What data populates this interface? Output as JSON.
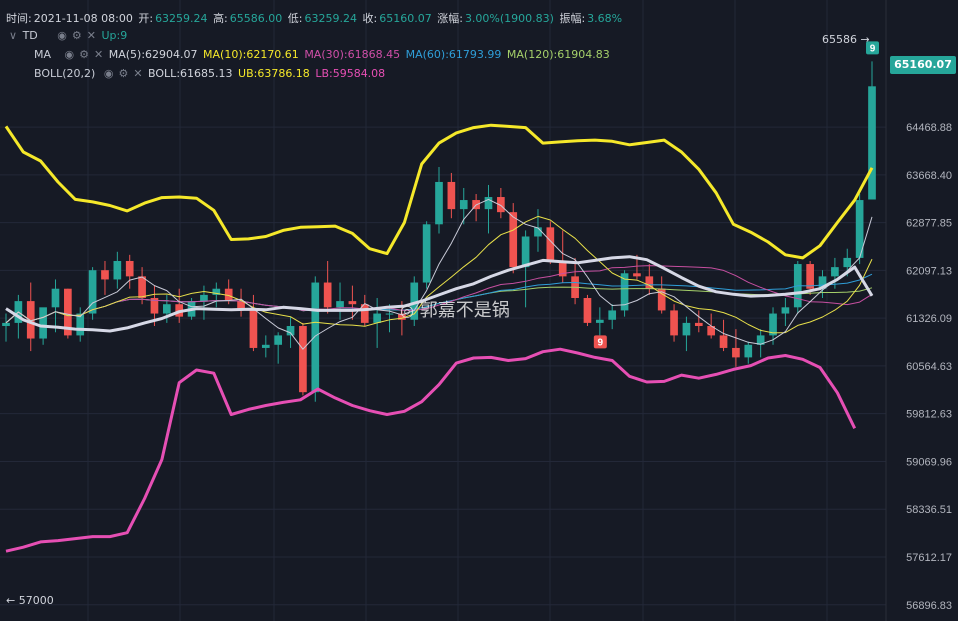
{
  "ohlc_line": {
    "time_label": "时间:",
    "time": "2021-11-08 08:00",
    "open_label": "开:",
    "open": "63259.24",
    "high_label": "高:",
    "high": "65586.00",
    "low_label": "低:",
    "low": "63259.24",
    "close_label": "收:",
    "close": "65160.07",
    "change_label": "涨幅:",
    "change": "3.00%(1900.83)",
    "amplitude_label": "振幅:",
    "amplitude": "3.68%"
  },
  "indicators": {
    "td": {
      "name": "TD",
      "value": "Up:9"
    },
    "ma": {
      "name": "MA",
      "ma5": "MA(5):62904.07",
      "ma10": "MA(10):62170.61",
      "ma30": "MA(30):61868.45",
      "ma60": "MA(60):61793.99",
      "ma120": "MA(120):61904.83"
    },
    "boll": {
      "name": "BOLL(20,2)",
      "mid": "BOLL:61685.13",
      "ub": "UB:63786.18",
      "lb": "LB:59584.08"
    }
  },
  "colors": {
    "bg": "#161a25",
    "up": "#26a69a",
    "down": "#ef5350",
    "grid": "#232838",
    "ma5": "#c9cbd8",
    "ma10": "#e8e04a",
    "ma30": "#c64fa0",
    "ma60": "#2f9ed8",
    "ma120": "#a5d06a",
    "boll": "#d6d8e6",
    "ub": "#f5e82a",
    "lb": "#e64fb4"
  },
  "price_axis": {
    "ticks": [
      "64468.88",
      "63668.40",
      "62877.85",
      "62097.13",
      "61326.09",
      "60564.63",
      "59812.63",
      "59069.96",
      "58336.51",
      "57612.17",
      "56896.83"
    ],
    "current_price": "65160.07",
    "high_marker": "65586 →",
    "low_marker": "← 57000"
  },
  "td_markers": [
    "9",
    "9"
  ],
  "watermark": "郭嘉不是锅",
  "chart_data": {
    "type": "candlestick",
    "y_scale": "log",
    "ylim": [
      56700,
      66300
    ],
    "candles": [
      [
        61200,
        61400,
        60950,
        61250
      ],
      [
        61250,
        61700,
        61000,
        61600
      ],
      [
        61600,
        61900,
        60800,
        61000
      ],
      [
        61000,
        61450,
        60900,
        61500
      ],
      [
        61500,
        61950,
        61100,
        61800
      ],
      [
        61800,
        61800,
        61000,
        61050
      ],
      [
        61050,
        61500,
        60950,
        61400
      ],
      [
        61400,
        62150,
        61300,
        62100
      ],
      [
        62100,
        62250,
        61700,
        61950
      ],
      [
        61950,
        62400,
        61800,
        62250
      ],
      [
        62250,
        62350,
        61800,
        62000
      ],
      [
        62000,
        62150,
        61550,
        61650
      ],
      [
        61650,
        61850,
        61200,
        61400
      ],
      [
        61400,
        61700,
        61250,
        61550
      ],
      [
        61550,
        61800,
        61250,
        61350
      ],
      [
        61350,
        61650,
        61300,
        61600
      ],
      [
        61600,
        61850,
        61300,
        61700
      ],
      [
        61700,
        61900,
        61500,
        61800
      ],
      [
        61800,
        61950,
        61550,
        61600
      ],
      [
        61600,
        61800,
        61350,
        61450
      ],
      [
        61450,
        61700,
        60800,
        60850
      ],
      [
        60850,
        61050,
        60700,
        60900
      ],
      [
        60900,
        61100,
        60600,
        61050
      ],
      [
        61050,
        61350,
        60850,
        61200
      ],
      [
        61200,
        61250,
        60100,
        60150
      ],
      [
        60150,
        62000,
        60000,
        61900
      ],
      [
        61900,
        62250,
        61400,
        61500
      ],
      [
        61500,
        61900,
        61300,
        61600
      ],
      [
        61600,
        61850,
        61300,
        61550
      ],
      [
        61550,
        61700,
        61200,
        61250
      ],
      [
        61250,
        61650,
        60850,
        61400
      ],
      [
        61400,
        61550,
        61100,
        61400
      ],
      [
        61400,
        61600,
        61050,
        61300
      ],
      [
        61300,
        62000,
        61200,
        61900
      ],
      [
        61900,
        62900,
        61800,
        62850
      ],
      [
        62850,
        63800,
        62700,
        63550
      ],
      [
        63550,
        63700,
        62950,
        63100
      ],
      [
        63100,
        63450,
        62850,
        63250
      ],
      [
        63250,
        63350,
        62900,
        63100
      ],
      [
        63100,
        63500,
        62700,
        63300
      ],
      [
        63300,
        63450,
        62950,
        63050
      ],
      [
        63050,
        63200,
        62050,
        62150
      ],
      [
        62150,
        62750,
        61500,
        62650
      ],
      [
        62650,
        63100,
        62400,
        62800
      ],
      [
        62800,
        62900,
        62200,
        62250
      ],
      [
        62250,
        62750,
        61900,
        62000
      ],
      [
        62000,
        62300,
        61550,
        61650
      ],
      [
        61650,
        61700,
        61200,
        61250
      ],
      [
        61250,
        61500,
        61050,
        61300
      ],
      [
        61300,
        61550,
        61150,
        61450
      ],
      [
        61450,
        62100,
        61350,
        62050
      ],
      [
        62050,
        62350,
        61950,
        62000
      ],
      [
        62000,
        62200,
        61700,
        61800
      ],
      [
        61800,
        62000,
        61400,
        61450
      ],
      [
        61450,
        61550,
        60950,
        61050
      ],
      [
        61050,
        61350,
        60800,
        61250
      ],
      [
        61250,
        61450,
        61100,
        61200
      ],
      [
        61200,
        61400,
        61000,
        61050
      ],
      [
        61050,
        61300,
        60800,
        60850
      ],
      [
        60850,
        61150,
        60550,
        60700
      ],
      [
        60700,
        60950,
        60600,
        60900
      ],
      [
        60900,
        61150,
        60700,
        61050
      ],
      [
        61050,
        61500,
        60900,
        61400
      ],
      [
        61400,
        61650,
        61200,
        61500
      ],
      [
        61500,
        62250,
        61400,
        62200
      ],
      [
        62200,
        62250,
        61700,
        61800
      ],
      [
        61800,
        62100,
        61650,
        62000
      ],
      [
        62000,
        62300,
        61800,
        62150
      ],
      [
        62150,
        62450,
        62000,
        62300
      ],
      [
        62300,
        63350,
        62200,
        63250
      ],
      [
        63259.24,
        65586,
        63259.24,
        65160.07
      ]
    ],
    "bands": {
      "UB": [
        64480,
        64050,
        63900,
        63550,
        63260,
        63220,
        63160,
        63070,
        63200,
        63290,
        63300,
        63280,
        63080,
        62600,
        62610,
        62650,
        62750,
        62800,
        62810,
        62820,
        62700,
        62450,
        62370,
        62880,
        63850,
        64200,
        64370,
        64460,
        64500,
        64480,
        64460,
        64200,
        64220,
        64240,
        64250,
        64230,
        64170,
        64210,
        64250,
        64050,
        63760,
        63370,
        62850,
        62720,
        62560,
        62350,
        62300,
        62500,
        62880,
        63250,
        63786.18
      ],
      "BOLL": [
        61480,
        61300,
        61200,
        61180,
        61150,
        61140,
        61120,
        61170,
        61250,
        61320,
        61430,
        61480,
        61470,
        61460,
        61470,
        61460,
        61500,
        61480,
        61450,
        61450,
        61450,
        61470,
        61500,
        61520,
        61600,
        61700,
        61800,
        61880,
        62000,
        62100,
        62180,
        62260,
        62240,
        62220,
        62260,
        62300,
        62320,
        62270,
        62130,
        61980,
        61840,
        61750,
        61710,
        61680,
        61690,
        61710,
        61740,
        61800,
        61950,
        62150,
        61685.13
      ],
      "LB": [
        57700,
        57760,
        57840,
        57860,
        57890,
        57920,
        57920,
        57980,
        58500,
        59100,
        60300,
        60500,
        60450,
        59800,
        59880,
        59940,
        59990,
        60030,
        60200,
        60060,
        59940,
        59860,
        59800,
        59850,
        60000,
        60270,
        60610,
        60690,
        60700,
        60650,
        60680,
        60790,
        60830,
        60770,
        60700,
        60650,
        60400,
        60310,
        60320,
        60420,
        60370,
        60430,
        60510,
        60570,
        60690,
        60730,
        60670,
        60540,
        60140,
        59584.08
      ]
    }
  }
}
